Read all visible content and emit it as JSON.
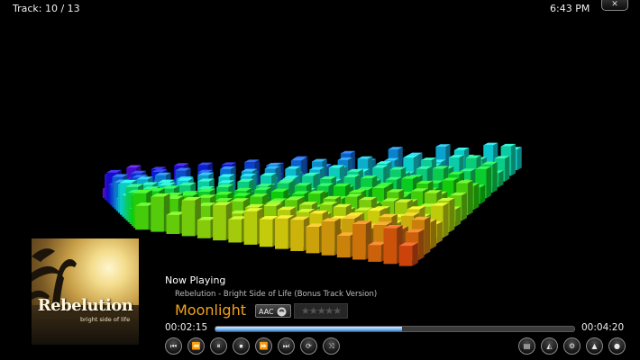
{
  "header": {
    "track_counter": "Track: 10 / 13",
    "clock": "6:43 PM",
    "close_label": "✕"
  },
  "album_art": {
    "title": "Rebelution",
    "subtitle": "bright side of life"
  },
  "now_playing": {
    "heading": "Now Playing",
    "album_line": "Rebelution - Bright Side of Life (Bonus Track Version)",
    "song": "Moonlight",
    "codec": "AAC",
    "rating_stars": "★★★★★",
    "rating_value": 0
  },
  "playback": {
    "elapsed": "00:02:15",
    "total": "00:04:20",
    "progress_fraction": 0.52
  },
  "transport": {
    "prev": "⏮",
    "rewind": "⏪",
    "pause": "⏸",
    "stop": "⏹",
    "forward": "⏩",
    "next": "⏭",
    "repeat": "⟳",
    "shuffle": "⤨"
  },
  "tools": {
    "subtitles": "▤",
    "visualization": "◭",
    "settings": "⚙",
    "analyzer": "▲",
    "record": "●"
  },
  "colors": {
    "accent_title": "#f0a21c",
    "progress_fill": "#7cb8f0"
  }
}
